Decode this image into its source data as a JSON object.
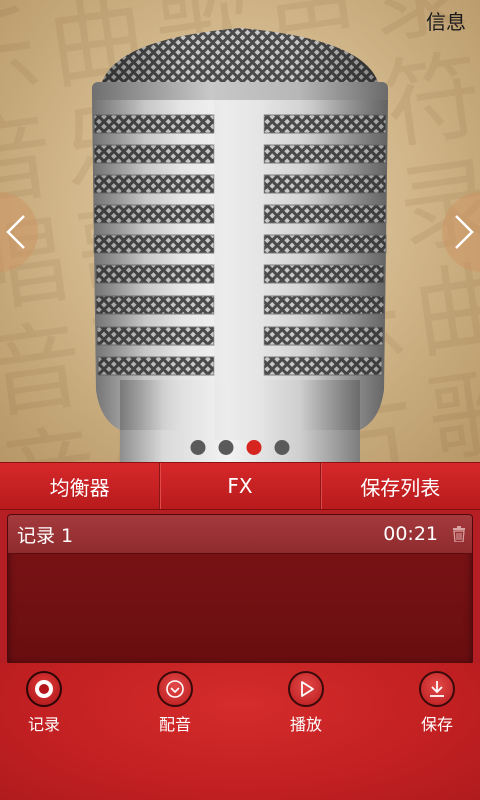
{
  "header": {
    "info_label": "信息"
  },
  "pager": {
    "pages": 4,
    "active_index": 2
  },
  "tabs": [
    {
      "label": "均衡器"
    },
    {
      "label": "FX"
    },
    {
      "label": "保存列表"
    }
  ],
  "recordings": [
    {
      "name": "记录 1",
      "duration": "00:21"
    }
  ],
  "toolbar": {
    "record_label": "记录",
    "dub_label": "配音",
    "play_label": "播放",
    "save_label": "保存"
  },
  "colors": {
    "accent_red": "#d6241f",
    "tab_bar": "#c42022",
    "list_bg": "#6a0e10"
  }
}
